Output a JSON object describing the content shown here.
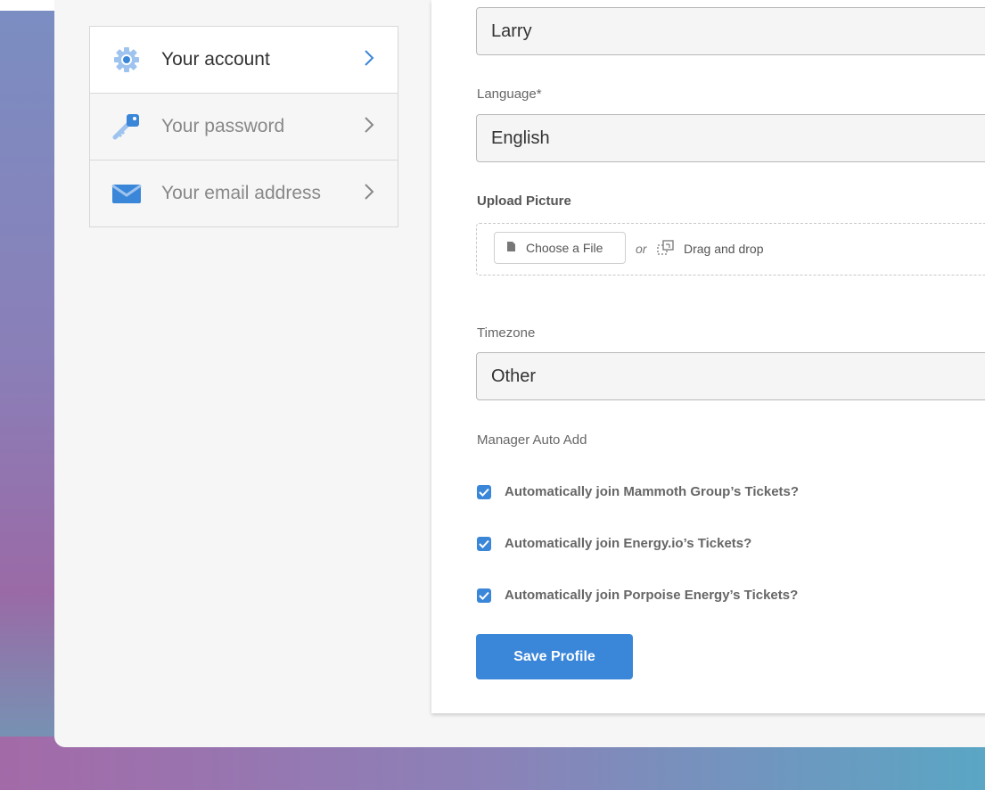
{
  "menu": {
    "items": [
      {
        "label": "Your account",
        "icon": "gear-icon",
        "active": true
      },
      {
        "label": "Your password",
        "icon": "key-icon",
        "active": false
      },
      {
        "label": "Your email address",
        "icon": "envelope-icon",
        "active": false
      }
    ]
  },
  "form": {
    "name_value": "Larry",
    "language_label": "Language*",
    "language_value": "English",
    "upload_label": "Upload Picture",
    "choose_file_label": "Choose a File",
    "or_text": "or",
    "drag_drop_label": "Drag and drop",
    "timezone_label": "Timezone",
    "timezone_value": "Other",
    "manager_auto_add_label": "Manager Auto Add",
    "checkboxes": [
      {
        "label": "Automatically join Mammoth Group’s Tickets?",
        "checked": true
      },
      {
        "label": "Automatically join Energy.io’s Tickets?",
        "checked": true
      },
      {
        "label": "Automatically join Porpoise Energy’s Tickets?",
        "checked": true
      }
    ],
    "save_label": "Save Profile"
  },
  "colors": {
    "accent": "#3a86d8",
    "panel_bg": "#f6f6f6",
    "text_muted": "#888888"
  }
}
